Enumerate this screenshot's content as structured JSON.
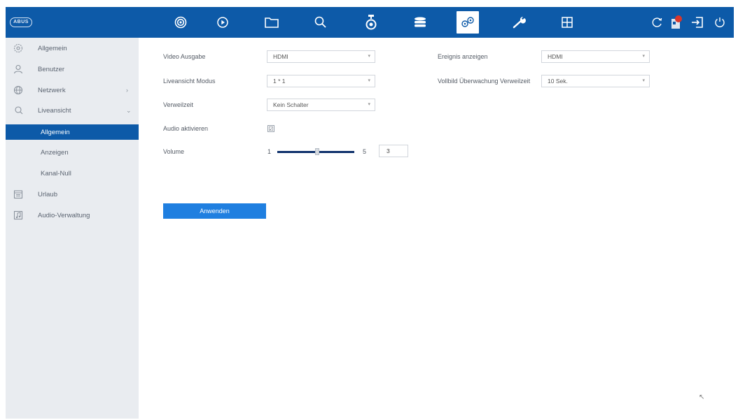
{
  "brand": {
    "logo": "ABUS"
  },
  "topbar": {
    "icons": [
      "live-view-icon",
      "playback-icon",
      "folder-icon",
      "search-icon",
      "camera-icon",
      "storage-icon",
      "settings-icon",
      "maintenance-icon",
      "layout-icon"
    ],
    "right_icons": [
      "refresh-icon",
      "alarm-icon",
      "logout-icon",
      "power-icon"
    ],
    "accent": "#0d5aa8"
  },
  "sidebar": {
    "items": [
      {
        "label": "Allgemein",
        "icon": "gear-icon"
      },
      {
        "label": "Benutzer",
        "icon": "user-icon"
      },
      {
        "label": "Netzwerk",
        "icon": "globe-icon",
        "chevron": "›"
      },
      {
        "label": "Liveansicht",
        "icon": "live-view-icon",
        "chevron": "⌄"
      },
      {
        "label": "Allgemein",
        "sub": true,
        "selected": true
      },
      {
        "label": "Anzeigen",
        "sub": true
      },
      {
        "label": "Kanal-Null",
        "sub": true
      },
      {
        "label": "Urlaub",
        "icon": "calendar-icon"
      },
      {
        "label": "Audio-Verwaltung",
        "icon": "audio-icon"
      }
    ]
  },
  "form": {
    "video_output": {
      "label": "Video Ausgabe",
      "value": "HDMI"
    },
    "live_mode": {
      "label": "Liveansicht Modus",
      "value": "1 * 1"
    },
    "dwell_time": {
      "label": "Verweilzeit",
      "value": "Kein Schalter"
    },
    "audio": {
      "label": "Audio aktivieren",
      "checked": true,
      "mark": "☑"
    },
    "volume": {
      "label": "Volume",
      "min": "1",
      "max": "5",
      "value": "3"
    },
    "event_display": {
      "label": "Ereignis anzeigen",
      "value": "HDMI"
    },
    "fullscreen_dwell": {
      "label": "Vollbild Überwachung Verweilzeit",
      "value": "10 Sek."
    },
    "apply_button": "Anwenden"
  }
}
